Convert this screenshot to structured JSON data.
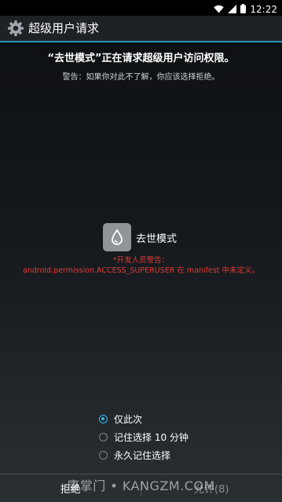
{
  "status_bar": {
    "time": "12:22"
  },
  "action_bar": {
    "title": "超级用户请求"
  },
  "headline": "“去世模式”正在请求超级用户访问权限。",
  "warning": "警告：如果你对此不了解，你应该选择拒绝。",
  "app": {
    "name": "去世模式"
  },
  "dev_warning": {
    "line1": "*开发人员警告：",
    "line2": "android.permission.ACCESS_SUPERUSER 在 manifest 中未定义。"
  },
  "options": [
    {
      "label": "仅此次",
      "checked": true
    },
    {
      "label": "记住选择 10 分钟",
      "checked": false
    },
    {
      "label": "永久记住选择",
      "checked": false
    }
  ],
  "buttons": {
    "deny": "拒绝",
    "grant": "允许(8)"
  },
  "watermark": "康掌门 • KANGZM.COM",
  "colors": {
    "accent": "#33b5e5",
    "warning_red": "#e53935",
    "divider": "#2f95b8"
  }
}
